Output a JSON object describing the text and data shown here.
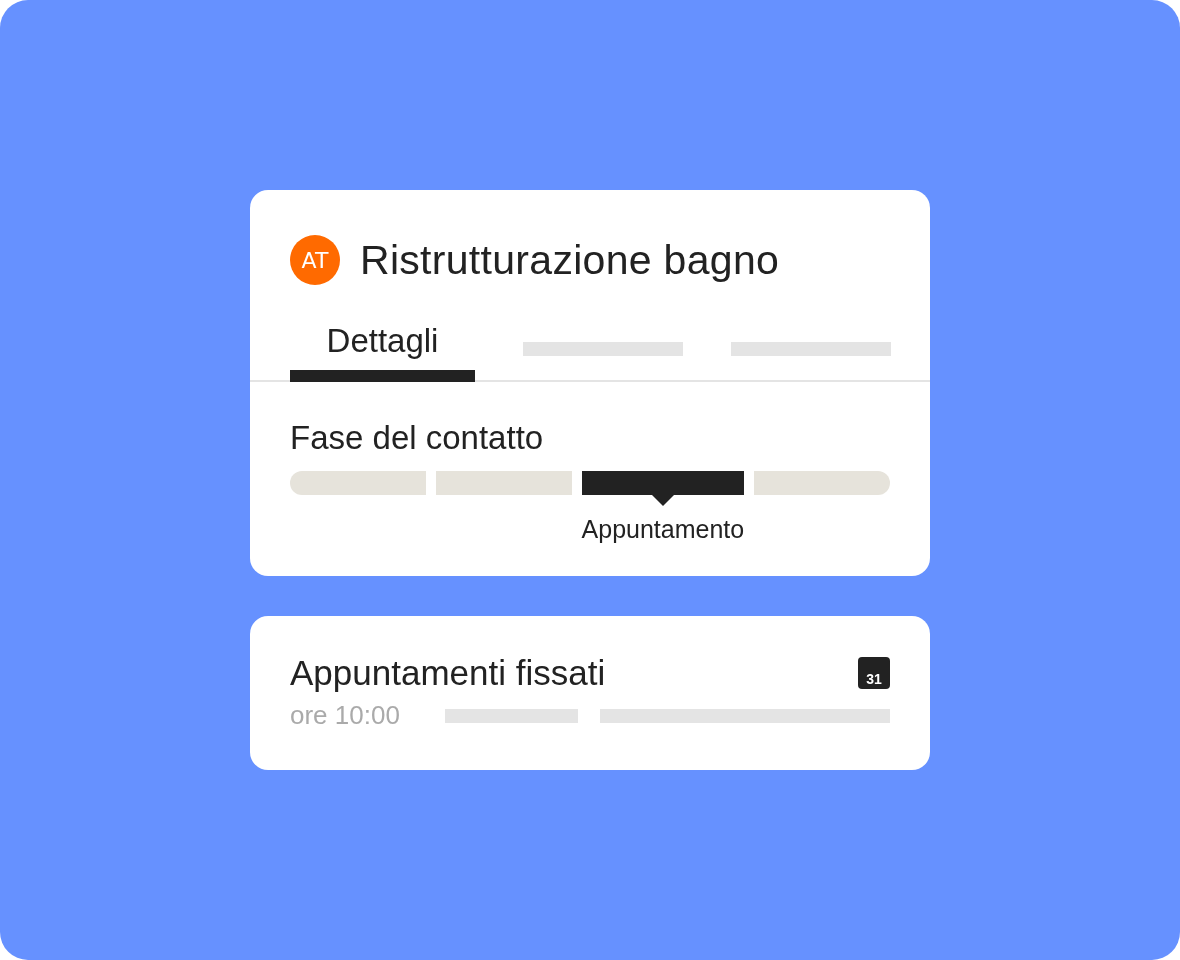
{
  "contact_card": {
    "avatar": "AT",
    "title": "Ristrutturazione bagno",
    "tabs": [
      {
        "kind": "text",
        "label": "Dettagli",
        "selected": true
      },
      {
        "kind": "placeholder",
        "selected": false
      },
      {
        "kind": "placeholder",
        "selected": false
      }
    ],
    "stage_heading": "Fase del contatto",
    "stages": [
      {
        "selected": false
      },
      {
        "selected": false
      },
      {
        "selected": true,
        "label": "Appuntamento"
      },
      {
        "selected": false
      }
    ]
  },
  "appointments_card": {
    "title": "Appuntamenti fissati",
    "calendar_day": "31",
    "time": "ore 10:00",
    "details": [
      {
        "kind": "placeholder"
      },
      {
        "kind": "placeholder"
      }
    ]
  }
}
